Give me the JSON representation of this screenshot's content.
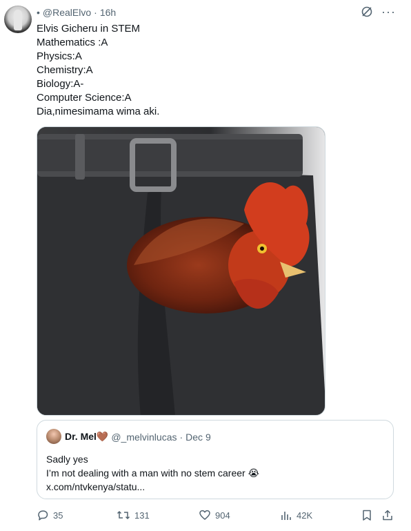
{
  "tweet": {
    "handle": "@RealElvo",
    "separator": "·",
    "time": "16h",
    "lines": [
      "Elvis Gicheru in STEM",
      "Mathematics :A",
      "Physics:A",
      "Chemistry:A",
      "Biology:A-",
      "Computer Science:A",
      "Dia,nimesimama wima aki."
    ]
  },
  "quote": {
    "name": "Dr. Mel",
    "name_emoji": "🤎",
    "handle": "@_melvinlucas",
    "separator": "·",
    "date": "Dec 9",
    "lines": [
      "Sadly yes",
      "I’m not dealing with a man with no stem career 😭",
      "x.com/ntvkenya/statu..."
    ]
  },
  "actions": {
    "replies": "35",
    "reposts": "131",
    "likes": "904",
    "views": "42K"
  },
  "icons": {
    "grok": "grok-icon",
    "more": "more-icon",
    "reply": "reply-icon",
    "repost": "repost-icon",
    "like": "heart-icon",
    "views": "views-icon",
    "bookmark": "bookmark-icon",
    "share": "share-icon"
  },
  "colors": {
    "secondary_text": "#536471",
    "border": "#cfd9de"
  }
}
